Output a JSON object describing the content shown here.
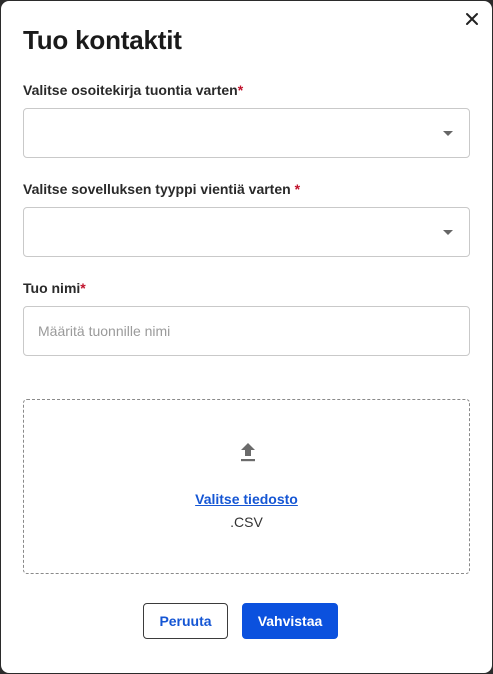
{
  "dialog": {
    "title": "Tuo kontaktit",
    "close_icon": "close-icon"
  },
  "address_book": {
    "label": "Valitse osoitekirja tuontia varten",
    "required_mark": "*",
    "value": ""
  },
  "app_type": {
    "label": "Valitse sovelluksen tyyppi vientiä varten ",
    "required_mark": "*",
    "value": ""
  },
  "import_name": {
    "label": "Tuo nimi",
    "required_mark": "*",
    "value": "",
    "placeholder": "Määritä tuonnille nimi"
  },
  "upload": {
    "icon": "upload-icon",
    "choose_label": "Valitse tiedosto",
    "file_type": ".CSV"
  },
  "actions": {
    "cancel_label": "Peruuta",
    "confirm_label": "Vahvistaa"
  },
  "colors": {
    "primary": "#0b51de",
    "link": "#1556d4",
    "required": "#c0112b"
  }
}
